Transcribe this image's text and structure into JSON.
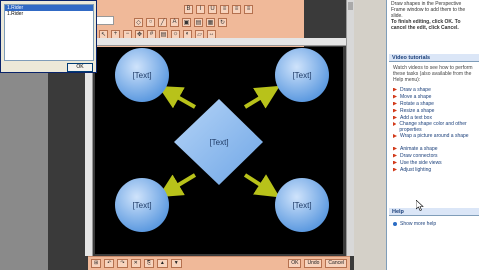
{
  "dialog": {
    "items": [
      "1.Rider",
      "1.Rider"
    ],
    "ok_label": "OK"
  },
  "editor": {
    "name_value": "Rider",
    "shapes": {
      "circle_top_left": "[Text]",
      "circle_top_right": "[Text]",
      "diamond_center": "[Text]",
      "circle_bottom_left": "[Text]",
      "circle_bottom_right": "[Text]"
    },
    "bottom_buttons": {
      "ok": "OK",
      "undo": "Undo",
      "cancel": "Cancel"
    }
  },
  "task_pane": {
    "intro": "Draw shapes in the Perspective Frame window to add them to the slide.",
    "finish": "To finish editing, click OK. To cancel the edit, click Cancel.",
    "tutorials_title": "Video tutorials",
    "tutorials_desc": "Watch videos to see how to perform these tasks (also available from the Help menu):",
    "links": [
      "Draw a shape",
      "Move a shape",
      "Rotate a shape",
      "Resize a shape",
      "Add a text box",
      "Change shape color and other properties",
      "Wrap a picture around a shape",
      "Animate a shape",
      "Draw connectors",
      "Use the side views",
      "Adjust lighting"
    ],
    "help_title": "Help",
    "help_link": "Show more help"
  },
  "colors": {
    "toolbar": "#f0b999",
    "canvas": "#000000",
    "circle": "#7aaeea",
    "diamond": "#8cbcf0",
    "arrow": "#b8c21a"
  }
}
